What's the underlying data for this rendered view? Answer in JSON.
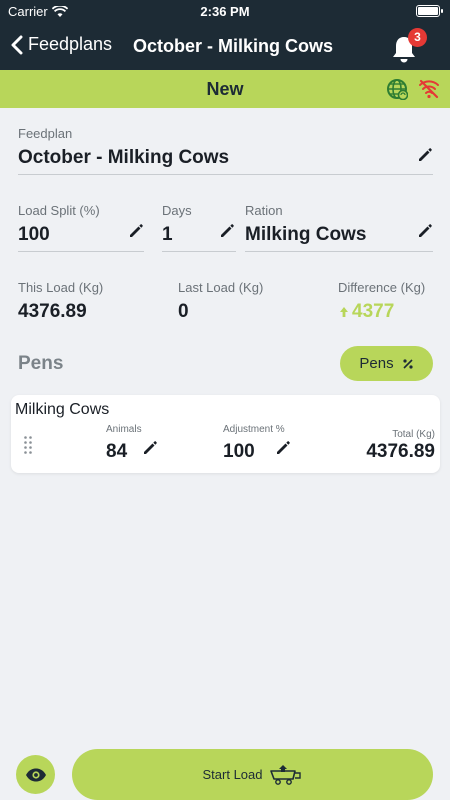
{
  "status_bar": {
    "carrier": "Carrier",
    "time": "2:36 PM"
  },
  "nav": {
    "back_label": "Feedplans",
    "title": "October - Milking Cows",
    "notification_count": "3",
    "icons": {
      "back": "chevron-left-icon",
      "bell": "bell-icon"
    }
  },
  "header": {
    "label": "New",
    "icons": {
      "globe": "globe-sync-icon",
      "wifi": "wifi-off-icon"
    },
    "colors": {
      "accent": "#b8d65a",
      "wifi_off": "#e53935",
      "globe": "#2e7d32"
    }
  },
  "form": {
    "feedplan": {
      "label": "Feedplan",
      "value": "October - Milking Cows"
    },
    "load_split": {
      "label": "Load Split (%)",
      "value": "100"
    },
    "days": {
      "label": "Days",
      "value": "1"
    },
    "ration": {
      "label": "Ration",
      "value": "Milking Cows"
    }
  },
  "stats": {
    "this_load": {
      "label": "This Load (Kg)",
      "value": "4376.89"
    },
    "last_load": {
      "label": "Last Load (Kg)",
      "value": "0"
    },
    "difference": {
      "label": "Difference (Kg)",
      "value": "4377",
      "direction": "up"
    }
  },
  "pens": {
    "title": "Pens",
    "button_label": "Pens",
    "button_icon": "percent-icon",
    "items": [
      {
        "name": "Milking Cows",
        "animals_label": "Animals",
        "animals": "84",
        "adjustment_label": "Adjustment %",
        "adjustment": "100",
        "total_label": "Total (Kg)",
        "total": "4376.89"
      }
    ]
  },
  "footer": {
    "eye_icon": "eye-icon",
    "start_label": "Start Load",
    "start_icon": "feed-wagon-icon"
  }
}
